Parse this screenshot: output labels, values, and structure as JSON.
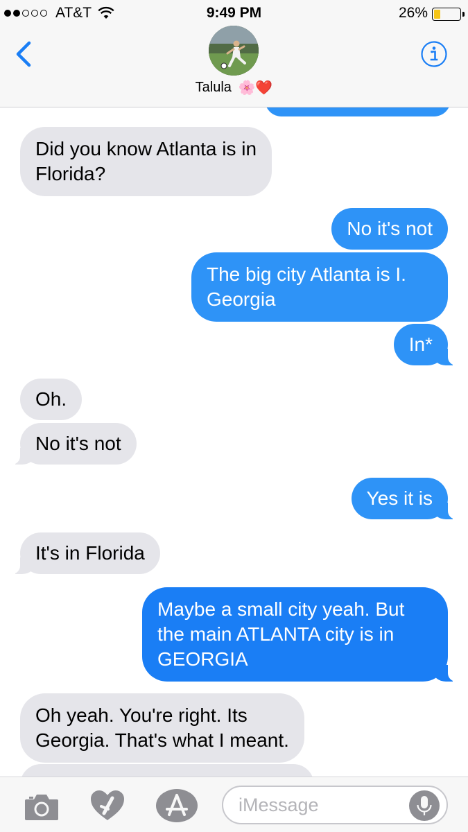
{
  "status_bar": {
    "carrier": "AT&T",
    "time": "9:49 PM",
    "battery": "26%",
    "battery_level": 0.26
  },
  "header": {
    "contact_name": "Talula",
    "name_emoji": "🌸❤️",
    "back_icon": "chevron-left-icon",
    "info_icon": "info-icon"
  },
  "messages": [
    {
      "from": "recv",
      "lines": [
        "Did you know Atlanta is in",
        "Florida?"
      ]
    },
    {
      "from": "sent",
      "lines": [
        "No it's not"
      ]
    },
    {
      "from": "sent",
      "lines": [
        "The big city Atlanta is I.",
        "Georgia"
      ]
    },
    {
      "from": "sent",
      "lines": [
        "In*"
      ]
    },
    {
      "from": "recv",
      "lines": [
        "Oh."
      ]
    },
    {
      "from": "recv",
      "lines": [
        "No it's not"
      ]
    },
    {
      "from": "sent",
      "lines": [
        "Yes it is"
      ]
    },
    {
      "from": "recv",
      "lines": [
        "It's in Florida"
      ]
    },
    {
      "from": "sent",
      "lines": [
        "Maybe a small city yeah. But",
        "the main ATLANTA city is in",
        "GEORGIA"
      ]
    },
    {
      "from": "recv",
      "lines": [
        "Oh yeah. You're right. Its",
        "Georgia. That's what I meant."
      ]
    }
  ],
  "composer": {
    "placeholder": "iMessage",
    "icons": [
      "camera-icon",
      "digital-touch-icon",
      "app-store-icon",
      "microphone-icon"
    ]
  },
  "colors": {
    "sent_bubble": "#2e93f7",
    "sent_bubble_dark": "#1a7ef5",
    "received_bubble": "#e5e5ea",
    "tint": "#1a7ef5"
  }
}
